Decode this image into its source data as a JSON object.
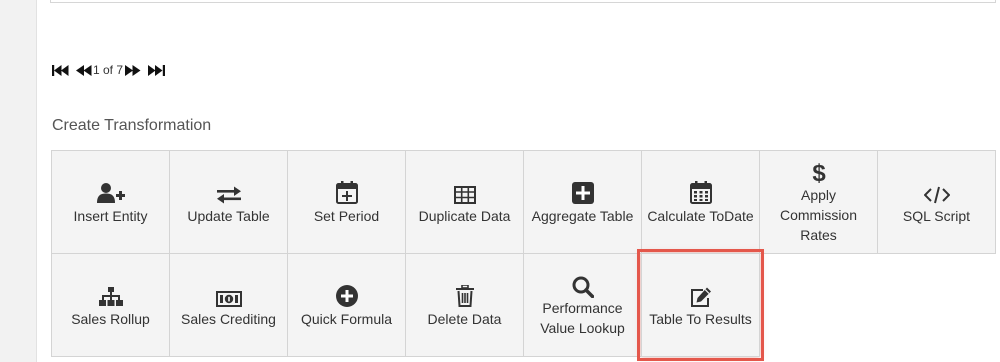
{
  "pager": {
    "page_text": "1 of 7"
  },
  "section": {
    "title": "Create Transformation"
  },
  "tiles": [
    {
      "label": "Insert Entity",
      "icon": "add-user-icon"
    },
    {
      "label": "Update Table",
      "icon": "swap-arrows-icon"
    },
    {
      "label": "Set Period",
      "icon": "calendar-plus-icon"
    },
    {
      "label": "Duplicate Data",
      "icon": "table-grid-icon"
    },
    {
      "label": "Aggregate Table",
      "icon": "plus-square-icon"
    },
    {
      "label": "Calculate ToDate",
      "icon": "calendar-icon"
    },
    {
      "label": "Apply Commission Rates",
      "icon": "dollar-icon"
    },
    {
      "label": "SQL Script",
      "icon": "code-icon"
    },
    {
      "label": "Sales Rollup",
      "icon": "sitemap-icon"
    },
    {
      "label": "Sales Crediting",
      "icon": "money-bill-icon"
    },
    {
      "label": "Quick Formula",
      "icon": "plus-circle-icon"
    },
    {
      "label": "Delete Data",
      "icon": "trash-icon"
    },
    {
      "label": "Performance Value Lookup",
      "icon": "search-icon"
    },
    {
      "label": "Table To Results",
      "icon": "edit-icon"
    }
  ],
  "highlight_color": "#e4574b"
}
